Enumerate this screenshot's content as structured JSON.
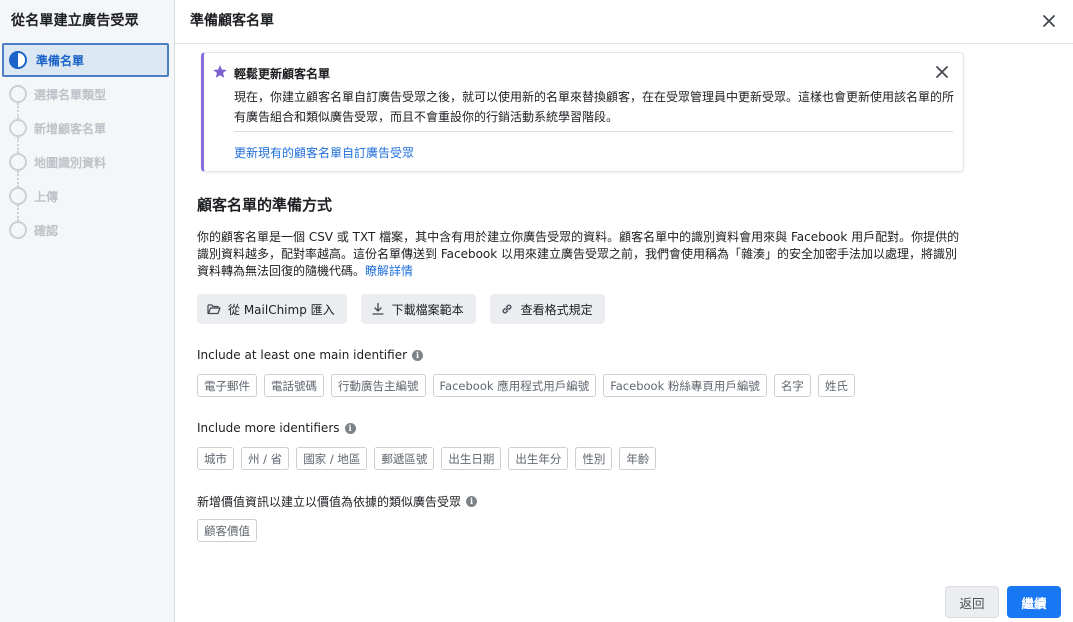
{
  "sidebar": {
    "title": "從名單建立廣告受眾",
    "steps": [
      {
        "label": "準備名單",
        "active": true
      },
      {
        "label": "選擇名單類型",
        "active": false
      },
      {
        "label": "新增顧客名單",
        "active": false
      },
      {
        "label": "地圖識別資料",
        "active": false
      },
      {
        "label": "上傳",
        "active": false
      },
      {
        "label": "確認",
        "active": false
      }
    ]
  },
  "header": {
    "title": "準備顧客名單",
    "close_icon": "close-icon"
  },
  "notice": {
    "icon": "star-icon",
    "title": "輕鬆更新顧客名單",
    "body": "現在，你建立顧客名單自訂廣告受眾之後，就可以使用新的名單來替換顧客，在在受眾管理員中更新受眾。這樣也會更新使用該名單的所有廣告組合和類似廣告受眾，而且不會重設你的行銷活動系統學習階段。",
    "link": "更新現有的顧客名單自訂廣告受眾",
    "accent_color": "#8a6ed8"
  },
  "section": {
    "title": "顧客名單的準備方式",
    "description": "你的顧客名單是一個 CSV 或 TXT 檔案，其中含有用於建立你廣告受眾的資料。顧客名單中的識別資料會用來與 Facebook 用戶配對。你提供的識別資料越多，配對率越高。這份名單傳送到 Facebook 以用來建立廣告受眾之前，我們會使用稱為「雜湊」的安全加密手法加以處理，將識別資料轉為無法回復的隨機代碼。",
    "learn_more": "瞭解詳情"
  },
  "actions": [
    {
      "label": "從 MailChimp 匯入",
      "icon": "folder-open-icon"
    },
    {
      "label": "下載檔案範本",
      "icon": "download-icon"
    },
    {
      "label": "查看格式規定",
      "icon": "link-icon"
    }
  ],
  "groups": {
    "main": {
      "label": "Include at least one main identifier",
      "tags": [
        "電子郵件",
        "電話號碼",
        "行動廣告主編號",
        "Facebook 應用程式用戶編號",
        "Facebook 粉絲專頁用戶編號",
        "名字",
        "姓氏"
      ]
    },
    "more": {
      "label": "Include more identifiers",
      "tags": [
        "城市",
        "州 / 省",
        "國家 / 地區",
        "郵遞區號",
        "出生日期",
        "出生年分",
        "性別",
        "年齡"
      ]
    },
    "value": {
      "label": "新增價值資訊以建立以價值為依據的類似廣告受眾",
      "tags": [
        "顧客價值"
      ]
    }
  },
  "footer": {
    "back": "返回",
    "next": "繼續",
    "primary_color": "#1877f2"
  }
}
